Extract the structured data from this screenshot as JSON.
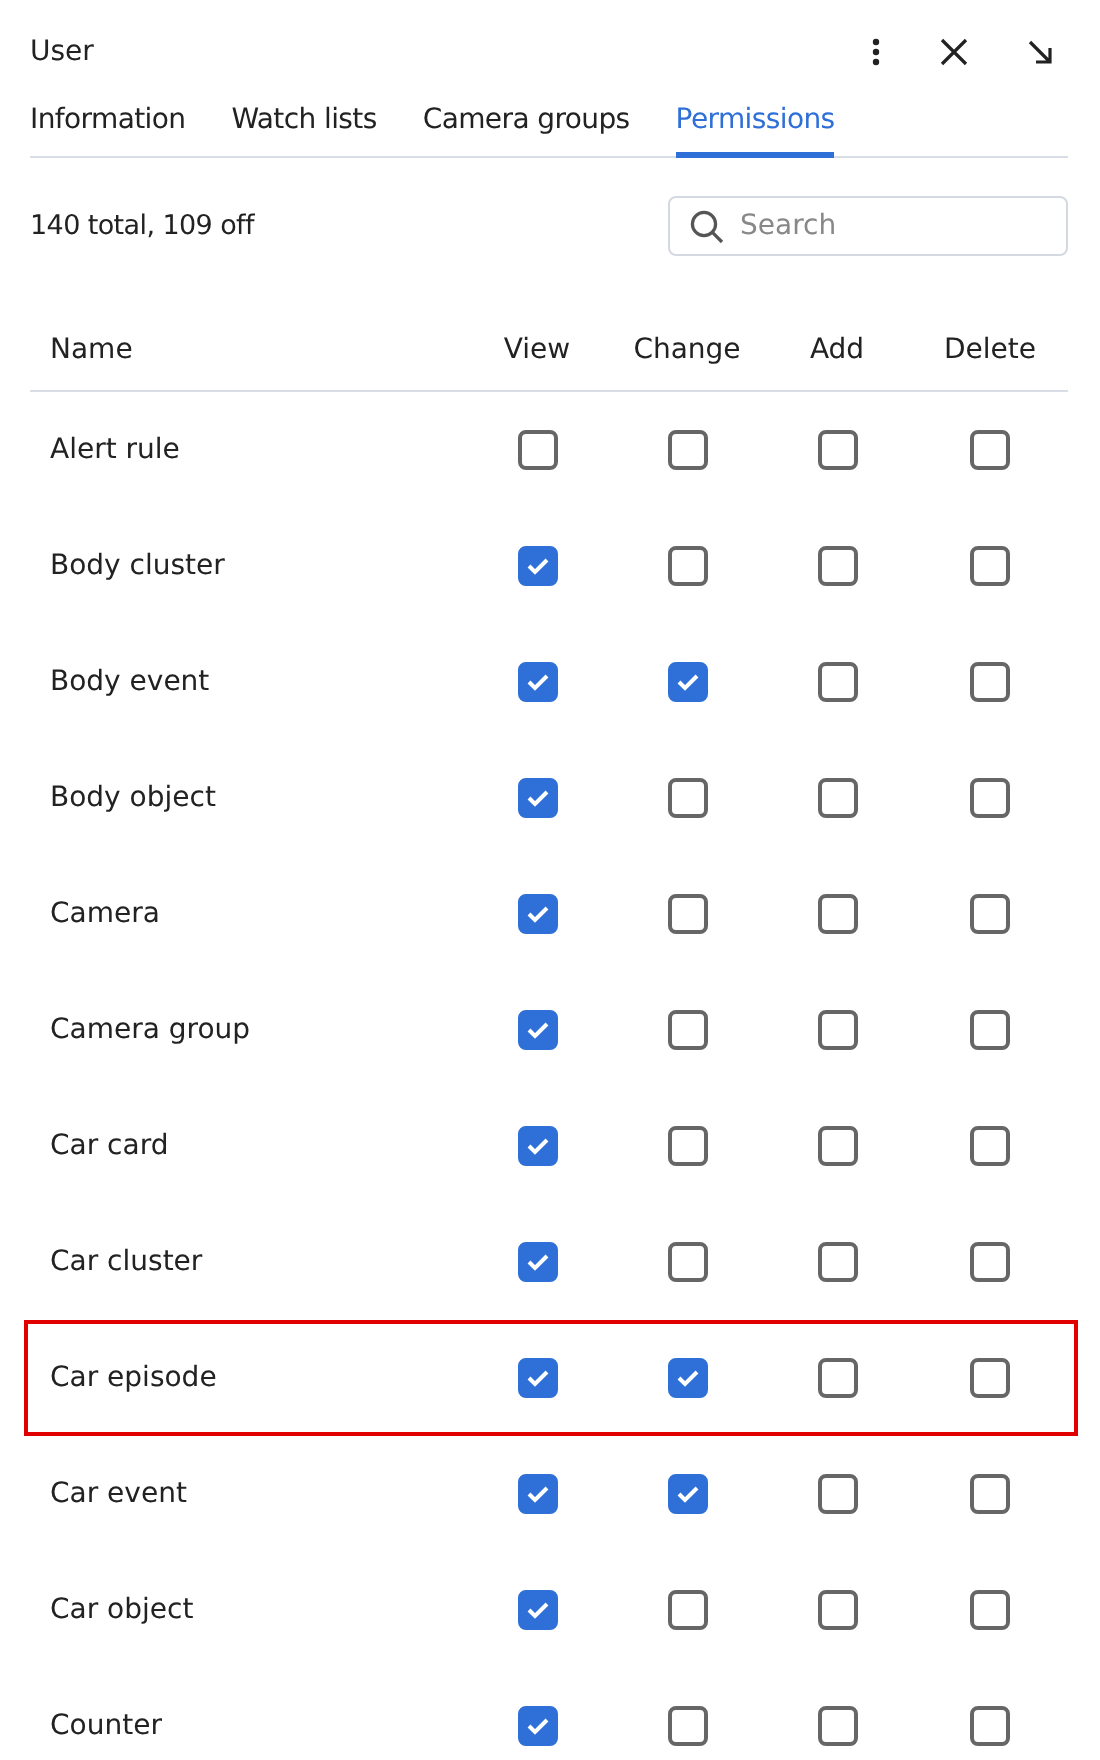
{
  "window": {
    "title": "User"
  },
  "tabs": [
    {
      "label": "Information",
      "selected": false
    },
    {
      "label": "Watch lists",
      "selected": false
    },
    {
      "label": "Camera groups",
      "selected": false
    },
    {
      "label": "Permissions",
      "selected": true
    }
  ],
  "summary": "140 total, 109 off",
  "search": {
    "placeholder": "Search"
  },
  "table": {
    "columns": [
      "Name",
      "View",
      "Change",
      "Add",
      "Delete"
    ],
    "rows": [
      {
        "name": "Alert rule",
        "view": false,
        "change": false,
        "add": false,
        "delete": false,
        "highlighted": false
      },
      {
        "name": "Body cluster",
        "view": true,
        "change": false,
        "add": false,
        "delete": false,
        "highlighted": false
      },
      {
        "name": "Body event",
        "view": true,
        "change": true,
        "add": false,
        "delete": false,
        "highlighted": false
      },
      {
        "name": "Body object",
        "view": true,
        "change": false,
        "add": false,
        "delete": false,
        "highlighted": false
      },
      {
        "name": "Camera",
        "view": true,
        "change": false,
        "add": false,
        "delete": false,
        "highlighted": false
      },
      {
        "name": "Camera group",
        "view": true,
        "change": false,
        "add": false,
        "delete": false,
        "highlighted": false
      },
      {
        "name": "Car card",
        "view": true,
        "change": false,
        "add": false,
        "delete": false,
        "highlighted": false
      },
      {
        "name": "Car cluster",
        "view": true,
        "change": false,
        "add": false,
        "delete": false,
        "highlighted": false
      },
      {
        "name": "Car episode",
        "view": true,
        "change": true,
        "add": false,
        "delete": false,
        "highlighted": true
      },
      {
        "name": "Car event",
        "view": true,
        "change": true,
        "add": false,
        "delete": false,
        "highlighted": false
      },
      {
        "name": "Car object",
        "view": true,
        "change": false,
        "add": false,
        "delete": false,
        "highlighted": false
      },
      {
        "name": "Counter",
        "view": true,
        "change": false,
        "add": false,
        "delete": false,
        "highlighted": false
      }
    ]
  }
}
